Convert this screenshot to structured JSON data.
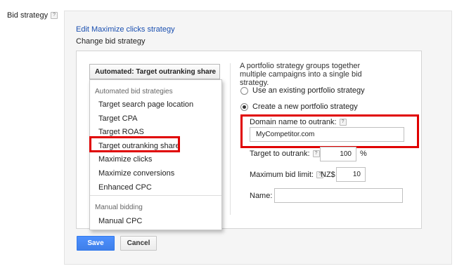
{
  "row_label": "Bid strategy",
  "help_icon_glyph": "?",
  "edit_link": "Edit Maximize clicks strategy",
  "change_label": "Change bid strategy",
  "select": {
    "selected": "Automated: Target outranking share"
  },
  "dropdown": {
    "automated_header": "Automated bid strategies",
    "automated_items": [
      "Target search page location",
      "Target CPA",
      "Target ROAS",
      "Target outranking share",
      "Maximize clicks",
      "Maximize conversions",
      "Enhanced CPC"
    ],
    "manual_header": "Manual bidding",
    "manual_items": [
      "Manual CPC"
    ]
  },
  "portfolio": {
    "description": "A portfolio strategy groups together multiple campaigns into a single bid strategy.",
    "option_existing": "Use an existing portfolio strategy",
    "option_new": "Create a new portfolio strategy",
    "selected_option": "new"
  },
  "form": {
    "domain_label": "Domain name to outrank:",
    "domain_value": "MyCompetitor.com",
    "target_label": "Target to outrank:",
    "target_value": "100",
    "target_unit": "%",
    "max_bid_label": "Maximum bid limit:",
    "currency": "NZ$",
    "max_bid_value": "10",
    "name_label": "Name:",
    "name_value": ""
  },
  "buttons": {
    "save": "Save",
    "cancel": "Cancel"
  },
  "colors": {
    "highlight": "#e00000",
    "link": "#1a4fb0",
    "primary_button": "#4d90fe"
  }
}
